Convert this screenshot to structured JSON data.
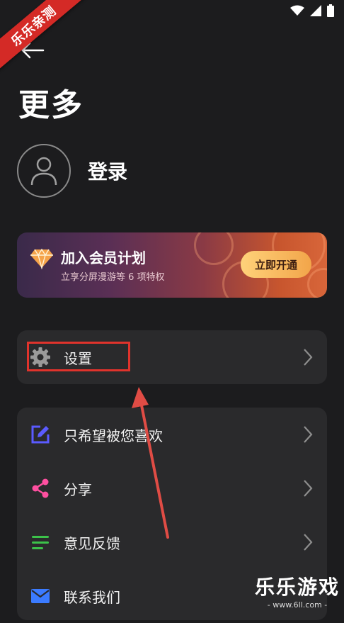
{
  "header": {
    "title": "更多"
  },
  "profile": {
    "login_label": "登录"
  },
  "vip": {
    "title": "加入会员计划",
    "subtitle": "立享分屏漫游等 6 项特权",
    "button": "立即开通",
    "accent": "#f2a54a"
  },
  "settings": {
    "label": "设置"
  },
  "menu": {
    "items": [
      {
        "label": "只希望被您喜欢",
        "icon": "edit-icon",
        "color": "#5b5bff"
      },
      {
        "label": "分享",
        "icon": "share-icon",
        "color": "#ff4fa0"
      },
      {
        "label": "意见反馈",
        "icon": "feedback-icon",
        "color": "#3cc24a"
      },
      {
        "label": "联系我们",
        "icon": "mail-icon",
        "color": "#3b7bff"
      }
    ]
  },
  "watermark": {
    "ribbon": "乐乐亲测",
    "corner_title": "乐乐游戏",
    "corner_url": "- www.6ll.com -"
  }
}
